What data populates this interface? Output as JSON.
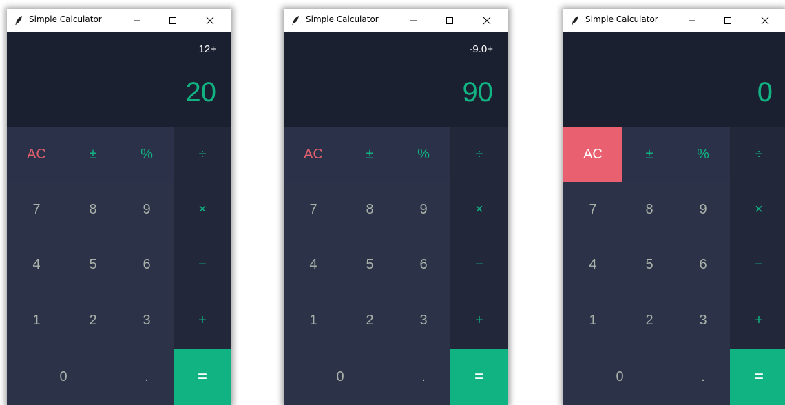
{
  "windows": [
    {
      "title": "Simple Calculator",
      "expression": "12+",
      "result": "20",
      "ac_highlighted": false
    },
    {
      "title": "Simple Calculator",
      "expression": "-9.0+",
      "result": "90",
      "ac_highlighted": false
    },
    {
      "title": "Simple Calculator",
      "expression": "",
      "result": "0",
      "ac_highlighted": true
    }
  ],
  "titlebar_icons": {
    "app": "feather-icon",
    "minimize": "minimize-icon",
    "maximize": "maximize-icon",
    "close": "close-icon"
  },
  "keys": {
    "ac": "AC",
    "plus_minus": "±",
    "percent": "%",
    "divide": "÷",
    "multiply": "×",
    "minus": "−",
    "plus": "+",
    "equals": "=",
    "decimal": ".",
    "digits": [
      "0",
      "1",
      "2",
      "3",
      "4",
      "5",
      "6",
      "7",
      "8",
      "9"
    ]
  },
  "colors": {
    "display_bg": "#1b2030",
    "pad_bg": "#2c3349",
    "operator_col_bg": "#222839",
    "accent_green": "#11b383",
    "ac_red": "#e0606e",
    "ac_active_bg": "#e96070",
    "digit_text": "#a9b2a9"
  }
}
